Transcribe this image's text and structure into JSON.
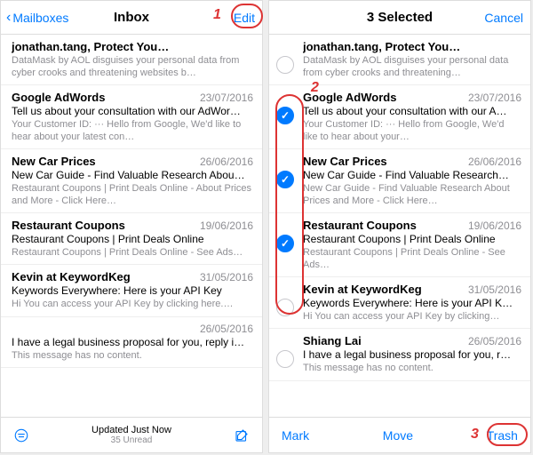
{
  "annotations": {
    "n1": "1",
    "n2": "2",
    "n3": "3"
  },
  "left": {
    "back": "Mailboxes",
    "title": "Inbox",
    "edit": "Edit",
    "status": {
      "line1": "Updated Just Now",
      "line2": "35 Unread"
    },
    "rows": [
      {
        "sender": "jonathan.tang, Protect Your Personal Data",
        "date": "",
        "subj": "",
        "prev": "DataMask by AOL disguises your personal data from cyber crooks and threatening websites b…"
      },
      {
        "sender": "Google AdWords",
        "date": "23/07/2016",
        "subj": "Tell us about your consultation with our AdWor…",
        "prev": "Your Customer ID: ··· Hello from Google, We'd like to hear about your latest con…"
      },
      {
        "sender": "New Car Prices",
        "date": "26/06/2016",
        "subj": "New Car Guide - Find Valuable Research Abou…",
        "prev": "Restaurant Coupons | Print Deals Online - About Prices and More - Click Here…"
      },
      {
        "sender": "Restaurant Coupons",
        "date": "19/06/2016",
        "subj": "Restaurant Coupons | Print Deals Online",
        "prev": "Restaurant Coupons | Print Deals Online - See Ads…"
      },
      {
        "sender": "Kevin at KeywordKeg",
        "date": "31/05/2016",
        "subj": "Keywords Everywhere: Here is your API Key",
        "prev": "Hi\nYou can access your API Key by clicking here.…"
      },
      {
        "sender": "",
        "date": "26/05/2016",
        "subj": "I have a legal business proposal for you, reply i…",
        "prev": "This message has no content."
      }
    ]
  },
  "right": {
    "title": "3 Selected",
    "cancel": "Cancel",
    "toolbar": {
      "mark": "Mark",
      "move": "Move",
      "trash": "Trash"
    },
    "rows": [
      {
        "sel": false,
        "sender": "jonathan.tang, Protect Your Personal Data",
        "date": "",
        "subj": "",
        "prev": "DataMask by AOL disguises your personal data from cyber crooks and threatening…"
      },
      {
        "sel": true,
        "sender": "Google AdWords",
        "date": "23/07/2016",
        "subj": "Tell us about your consultation with our A…",
        "prev": "Your Customer ID: ··· Hello from Google, We'd like to hear about your…"
      },
      {
        "sel": true,
        "sender": "New Car Prices",
        "date": "26/06/2016",
        "subj": "New Car Guide - Find Valuable Research…",
        "prev": "New Car Guide - Find Valuable Research About Prices and More - Click Here…"
      },
      {
        "sel": true,
        "sender": "Restaurant Coupons",
        "date": "19/06/2016",
        "subj": "Restaurant Coupons | Print Deals Online",
        "prev": "Restaurant Coupons | Print Deals Online - See Ads…"
      },
      {
        "sel": false,
        "sender": "Kevin at KeywordKeg",
        "date": "31/05/2016",
        "subj": "Keywords Everywhere: Here is your API K…",
        "prev": "Hi\nYou can access your API Key by clicking…"
      },
      {
        "sel": false,
        "sender": "Shiang Lai",
        "date": "26/05/2016",
        "subj": "I have a legal business proposal for you, r…",
        "prev": "This message has no content."
      }
    ]
  }
}
